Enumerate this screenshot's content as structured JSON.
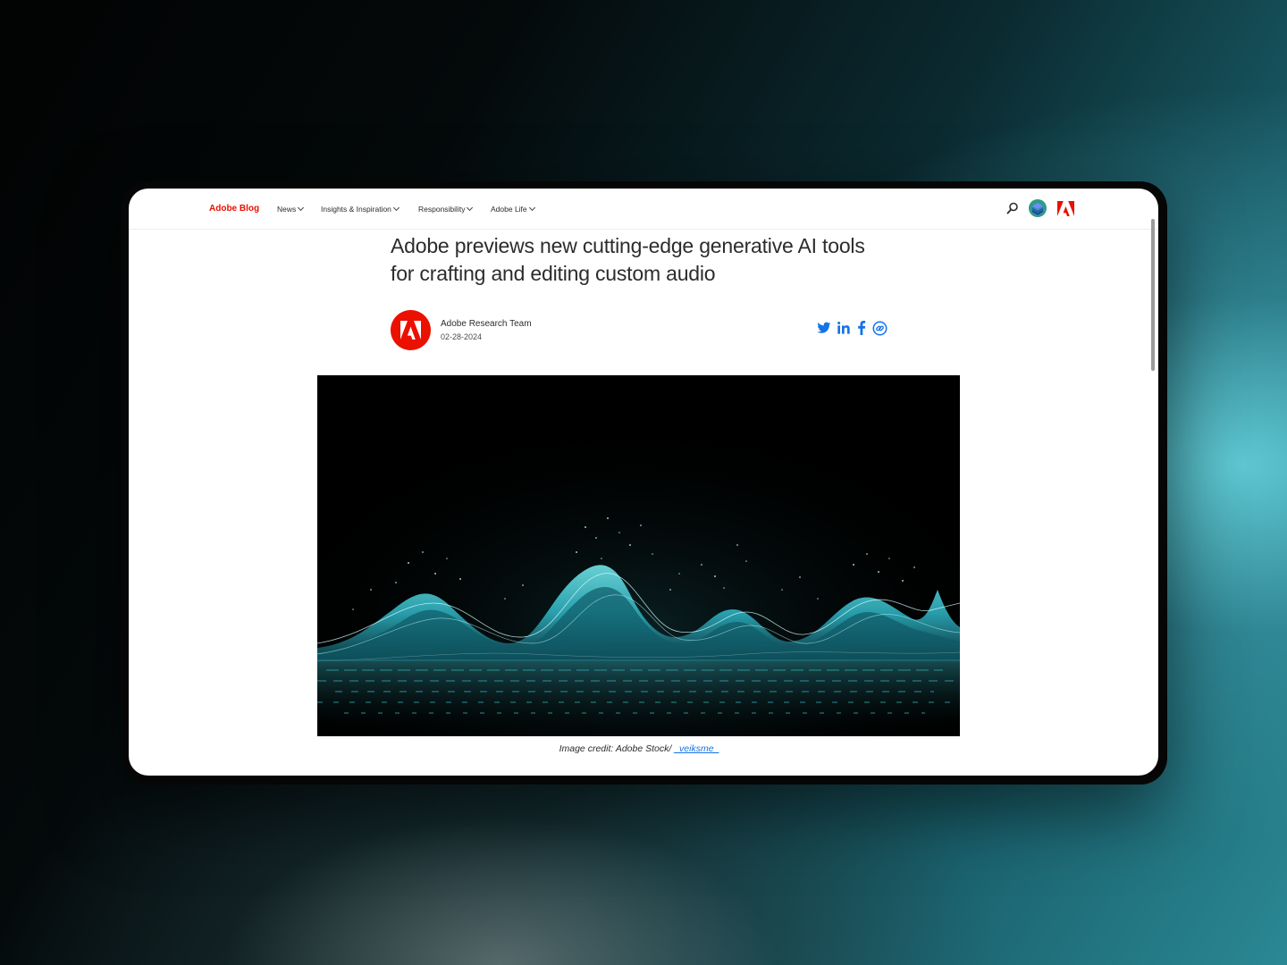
{
  "header": {
    "brand": "Adobe Blog",
    "nav": [
      {
        "label": "News"
      },
      {
        "label": "Insights & Inspiration"
      },
      {
        "label": "Responsibility"
      },
      {
        "label": "Adobe Life"
      }
    ],
    "icons": [
      "search-icon",
      "user-avatar-icon",
      "adobe-logo-icon"
    ]
  },
  "article": {
    "title": "Adobe previews new cutting-edge generative AI tools for crafting and editing custom audio",
    "author": {
      "name": "Adobe Research Team",
      "date": "02-28-2024",
      "avatar_icon": "adobe-logo-icon"
    },
    "share": [
      "twitter-icon",
      "linkedin-icon",
      "facebook-icon",
      "copy-link-icon"
    ],
    "image": {
      "description_icon": "audio-waveform-image",
      "caption_prefix": "Image credit: Adobe Stock/ ",
      "caption_link": "_veiksme_"
    }
  },
  "colors": {
    "brand_red": "#eb1000",
    "link_blue": "#1473e6",
    "text": "#2c2c2c",
    "waveform": "#3fd6e0"
  }
}
